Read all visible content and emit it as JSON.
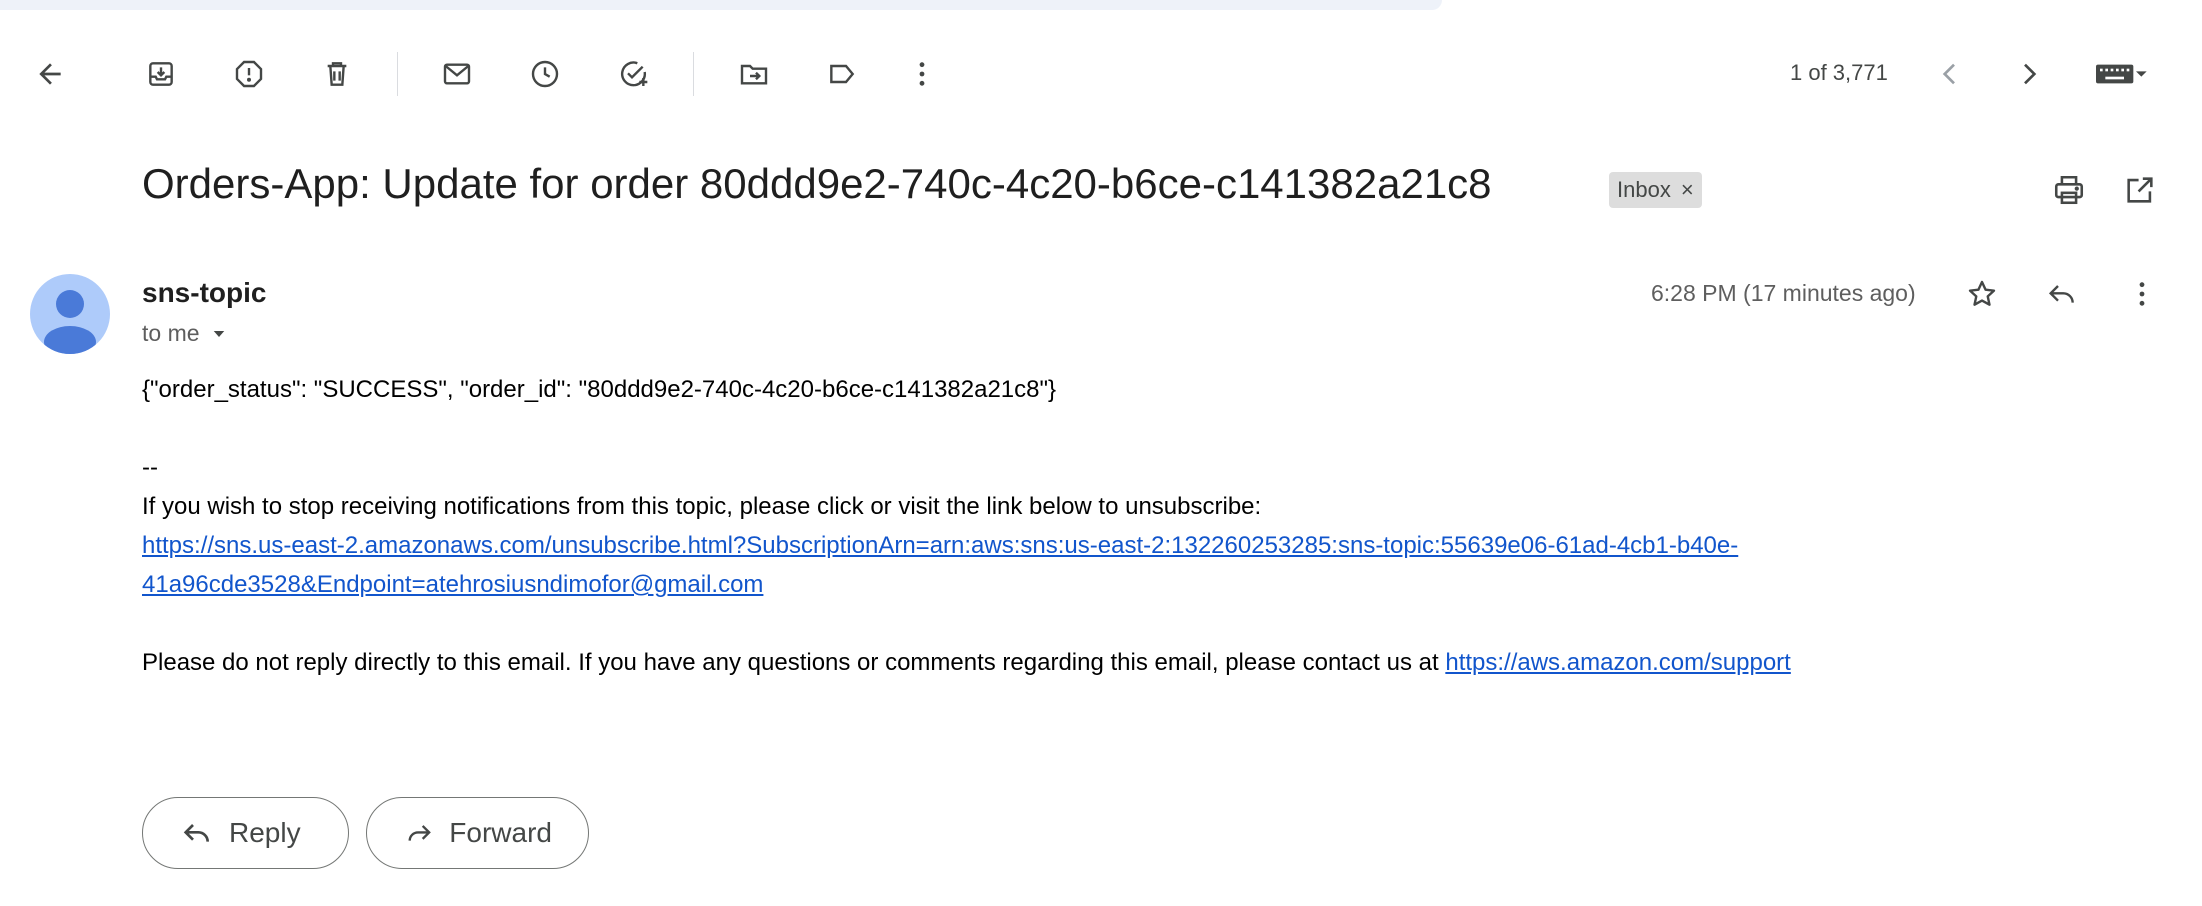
{
  "toolbar": {
    "pager": "1 of 3,771",
    "icons": [
      "back-arrow-icon",
      "archive-icon",
      "report-spam-icon",
      "delete-icon",
      "mark-unread-icon",
      "snooze-icon",
      "add-task-icon",
      "move-to-icon",
      "label-icon",
      "more-vert-icon",
      "prev-icon",
      "next-icon",
      "keyboard-icon"
    ]
  },
  "message": {
    "subject": "Orders-App: Update for order 80ddd9e2-740c-4c20-b6ce-c141382a21c8",
    "label": "Inbox",
    "label_close": "×",
    "sender": "sns-topic",
    "recipient": "to me",
    "time": "6:28 PM (17 minutes ago)",
    "body": {
      "json_line": "{\"order_status\": \"SUCCESS\", \"order_id\": \"80ddd9e2-740c-4c20-b6ce-c141382a21c8\"}",
      "separator": "--",
      "unsubscribe_text": "If you wish to stop receiving notifications from this topic, please click or visit the link below to unsubscribe:",
      "unsubscribe_link_line1": "https://sns.us-east-2.amazonaws.com/unsubscribe.html?SubscriptionArn=arn:aws:sns:us-east-2:132260253285:sns-topic:55639e06-61ad-4cb1-b40e-",
      "unsubscribe_link_line2": "41a96cde3528&Endpoint=atehrosiusndimofor@gmail.com",
      "noreply_text": "Please do not reply directly to this email. If you have any questions or comments regarding this email, please contact us at ",
      "support_link": "https://aws.amazon.com/support"
    }
  },
  "actions": {
    "reply": "Reply",
    "forward": "Forward"
  },
  "colors": {
    "link": "#1155cc",
    "avatar_bg": "#aecbfa",
    "avatar_fg": "#4a7ad8"
  }
}
